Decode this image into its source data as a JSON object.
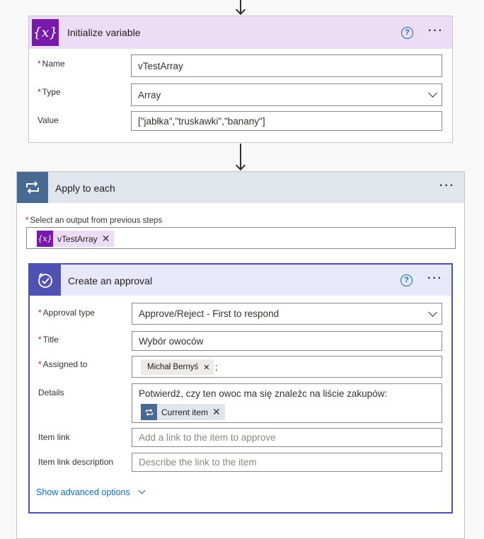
{
  "initialize_variable": {
    "title": "Initialize variable",
    "icon": "variable-icon",
    "fields": {
      "name_label": "Name",
      "name_value": "vTestArray",
      "type_label": "Type",
      "type_value": "Array",
      "value_label": "Value",
      "value_value": "[\"jabłka\",\"truskawki\",\"banany\"]"
    }
  },
  "apply_to_each": {
    "title": "Apply to each",
    "icon": "loop-icon",
    "select_label": "Select an output from previous steps",
    "token_label": "vTestArray"
  },
  "create_approval": {
    "title": "Create an approval",
    "icon": "approval-icon",
    "approval_type_label": "Approval type",
    "approval_type_value": "Approve/Reject - First to respond",
    "title_label": "Title",
    "title_value": "Wybór owoców",
    "assigned_label": "Assigned to",
    "assigned_person": "Michał Bernyś",
    "assigned_separator": ";",
    "details_label": "Details",
    "details_text": "Potwierdź, czy ten owoc ma się znaleźc na liście zakupów:",
    "details_token": "Current item",
    "item_link_label": "Item link",
    "item_link_placeholder": "Add a link to the item to approve",
    "item_link_desc_label": "Item link description",
    "item_link_desc_placeholder": "Describe the link to the item",
    "advanced_link": "Show advanced options"
  },
  "common": {
    "required_mark": "*",
    "help_glyph": "?",
    "more_glyph": "···",
    "remove_glyph": "✕",
    "variable_glyph": "{x}"
  },
  "colors": {
    "variable_accent": "#7719aa",
    "loop_accent": "#486991",
    "approval_accent": "#4f52b2",
    "link": "#0f6cbd"
  }
}
